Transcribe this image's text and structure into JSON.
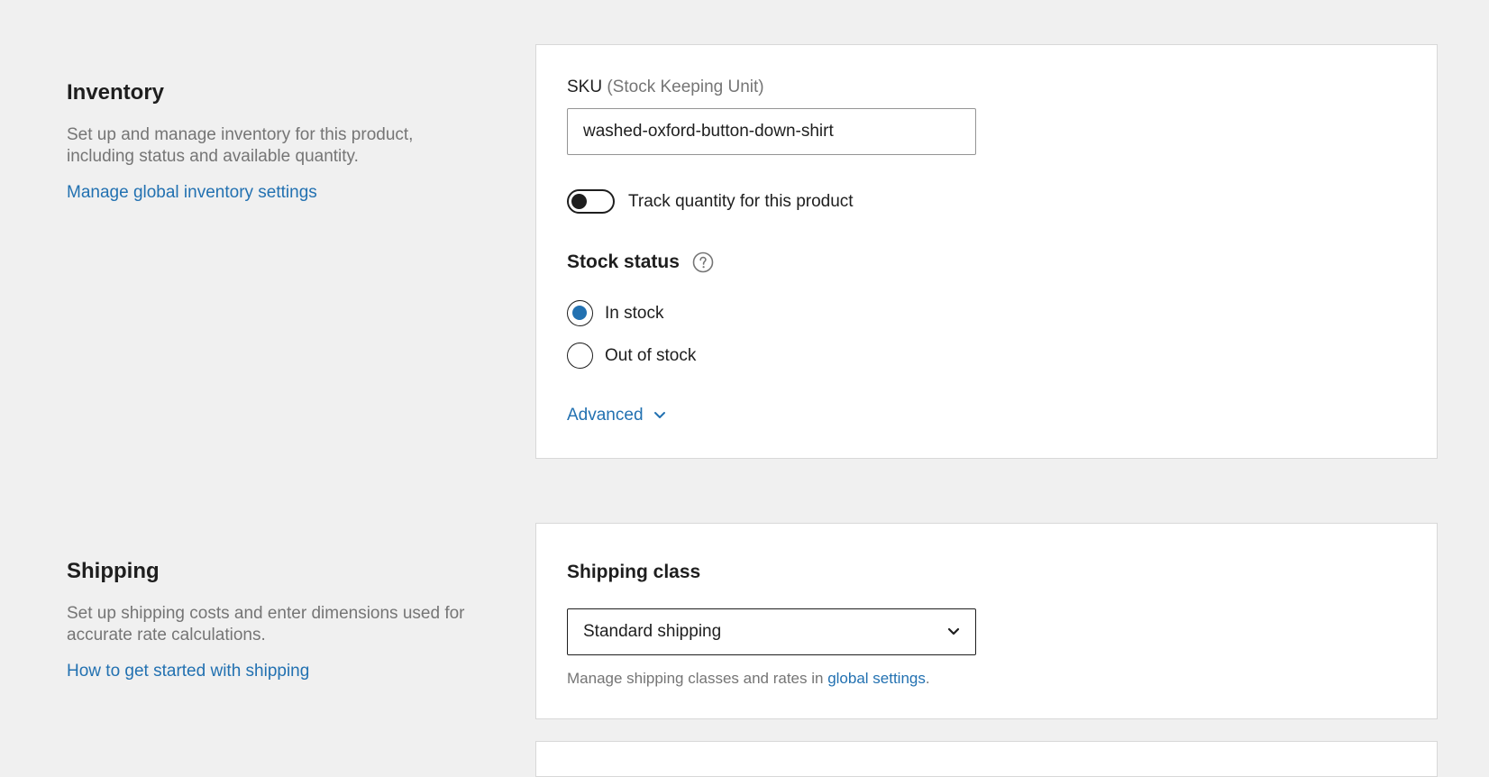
{
  "inventory": {
    "title": "Inventory",
    "description": "Set up and manage inventory for this product, including status and available quantity.",
    "link": "Manage global inventory settings",
    "sku": {
      "label": "SKU",
      "label_hint": "(Stock Keeping Unit)",
      "value": "washed-oxford-button-down-shirt"
    },
    "track_quantity": {
      "label": "Track quantity for this product",
      "enabled": false
    },
    "stock_status": {
      "heading": "Stock status",
      "help_icon": "question-circle-icon",
      "options": [
        {
          "label": "In stock",
          "checked": true
        },
        {
          "label": "Out of stock",
          "checked": false
        }
      ]
    },
    "advanced_label": "Advanced",
    "advanced_icon": "chevron-down-icon"
  },
  "shipping": {
    "title": "Shipping",
    "description": "Set up shipping costs and enter dimensions used for accurate rate calculations.",
    "link": "How to get started with shipping",
    "shipping_class": {
      "heading": "Shipping class",
      "selected": "Standard shipping",
      "help_prefix": "Manage shipping classes and rates in ",
      "help_link": "global settings",
      "help_suffix": "."
    }
  },
  "colors": {
    "accent": "#2271b1",
    "page_background": "#f0f0f0",
    "card_background": "#ffffff",
    "muted_text": "#757575"
  }
}
